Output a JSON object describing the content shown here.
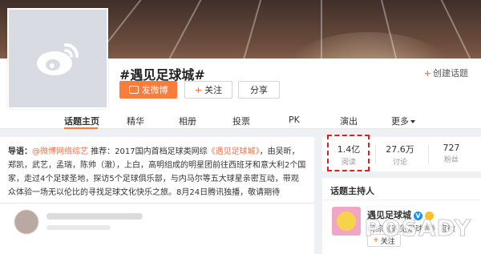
{
  "topic": {
    "title": "#遇见足球城#",
    "create_label": "创建话题"
  },
  "actions": {
    "post_label": "发微博",
    "follow_label": "关注",
    "share_label": "分享"
  },
  "tabs": [
    {
      "label": "话题主页",
      "active": true
    },
    {
      "label": "精华"
    },
    {
      "label": "相册"
    },
    {
      "label": "投票"
    },
    {
      "label": "PK"
    },
    {
      "label": "演出"
    },
    {
      "label": "更多"
    }
  ],
  "lead": {
    "label": "导语：",
    "mention": "@微博网络综艺",
    "text_before_link": " 推荐：2017国内首档足球类网综",
    "link": "《遇见足球城》",
    "text_after_link": "，由吴昕，郑凯，武艺，孟瑞，陈帅（澈），上白，高明组成的明星团前往西班牙和意大利2个国家，走过4个足球圣地，探访5个足球俱乐部，与内马尔等五大球星亲密互动，带观众体验一场无以伦比的寻找足球文化快乐之旅。8月24日腾讯独播，敬请期待"
  },
  "stats": [
    {
      "value": "1.4亿",
      "label": "阅读"
    },
    {
      "value": "27.6万",
      "label": "讨论"
    },
    {
      "value": "727",
      "label": "粉丝"
    }
  ],
  "host": {
    "section_title": "话题主持人",
    "name": "遇见足球城",
    "verified_mark": "V",
    "desc": "网综《遇见足球城》官微",
    "follow_label": "关注"
  },
  "watermark": "POSADY",
  "colors": {
    "accent": "#fa7d3c",
    "highlight": "#e02020",
    "link": "#eb7350"
  }
}
